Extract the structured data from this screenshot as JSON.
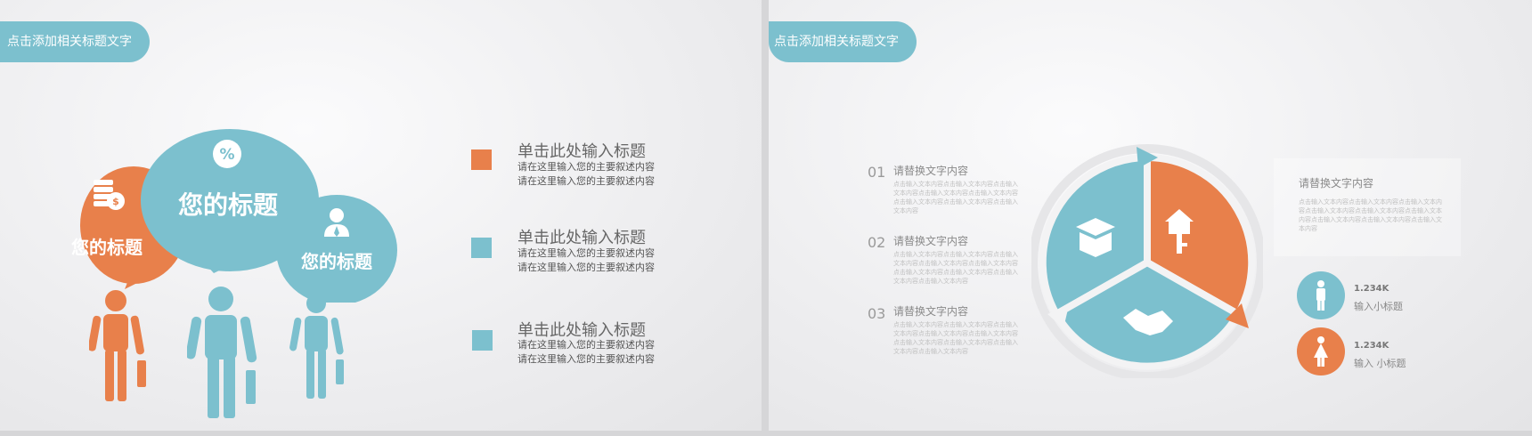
{
  "colors": {
    "orange": "#e8804b",
    "teal": "#7cc0ce",
    "light_teal": "#a9d6df"
  },
  "slide1": {
    "title_tab": "点击添加相关标题文字",
    "bubbles": [
      {
        "label": "您的标题",
        "icon": "coins-icon"
      },
      {
        "label": "您的标题",
        "icon": "percent-badge-icon"
      },
      {
        "label": "您的标题",
        "icon": "businessman-icon"
      }
    ],
    "items": [
      {
        "title": "单击此处输入标题",
        "desc1": "请在这里输入您的主要叙述内容",
        "desc2": "请在这里输入您的主要叙述内容",
        "color": "#e8804b"
      },
      {
        "title": "单击此处输入标题",
        "desc1": "请在这里输入您的主要叙述内容",
        "desc2": "请在这里输入您的主要叙述内容",
        "color": "#7cc0ce"
      },
      {
        "title": "单击此处输入标题",
        "desc1": "请在这里输入您的主要叙述内容",
        "desc2": "请在这里输入您的主要叙述内容",
        "color": "#7cc0ce"
      }
    ]
  },
  "slide2": {
    "title_tab": "点击添加相关标题文字",
    "list": [
      {
        "num": "01",
        "title": "请替换文字内容",
        "body": "点击输入文本内容点击输入文本内容点击输入文本内容点击输入文本内容点击输入文本内容点击输入文本内容点击输入文本内容点击输入文本内容"
      },
      {
        "num": "02",
        "title": "请替换文字内容",
        "body": "点击输入文本内容点击输入文本内容点击输入文本内容点击输入文本内容点击输入文本内容点击输入文本内容点击输入文本内容点击输入文本内容点击输入文本内容"
      },
      {
        "num": "03",
        "title": "请替换文字内容",
        "body": "点击输入文本内容点击输入文本内容点击输入文本内容点击输入文本内容点击输入文本内容点击输入文本内容点击输入文本内容点击输入文本内容点击输入文本内容"
      }
    ],
    "pie_icons": [
      "open-box-icon",
      "house-key-icon",
      "handshake-icon"
    ],
    "right_box": {
      "title": "请替换文字内容",
      "body": "点击输入文本内容点击输入文本内容点击输入文本内容点击输入文本内容点击输入文本内容点击输入文本内容点击输入文本内容点击输入文本内容点击输入文本内容"
    },
    "stats": [
      {
        "value": "1.234K",
        "label": "输入小标题",
        "icon": "male-person-icon",
        "color": "#7cc0ce"
      },
      {
        "value": "1.234K",
        "label": "输入 小标题",
        "icon": "female-person-icon",
        "color": "#e8804b"
      }
    ]
  }
}
